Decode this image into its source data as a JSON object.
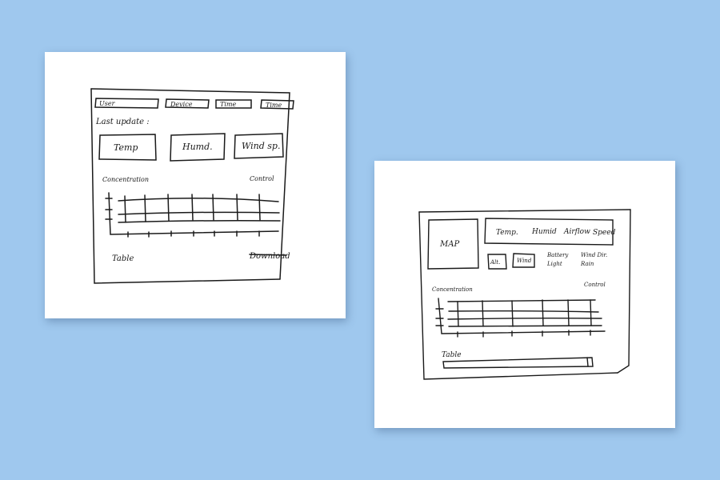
{
  "background_color": "#9fc8ee",
  "ink_color": "#1a1a1a",
  "sketch_1": {
    "filters": [
      "User",
      "Device",
      "Time",
      "Time"
    ],
    "last_update_label": "Last update :",
    "cards": [
      "Temp",
      "Humd.",
      "Wind sp."
    ],
    "concentration_label": "Concentration",
    "control_label": "Control",
    "table_label": "Table",
    "download_label": "Download"
  },
  "sketch_2": {
    "map_label": "MAP",
    "metrics": [
      "Temp.",
      "Humid",
      "Airflow",
      "Speed"
    ],
    "buttons": [
      "Alt.",
      "Wind"
    ],
    "extra_metrics_row1": [
      "Battery",
      "Wind Dir."
    ],
    "extra_metrics_row2": [
      "Light",
      "Rain"
    ],
    "concentration_label": "Concentration",
    "control_label": "Control",
    "table_label": "Table"
  }
}
